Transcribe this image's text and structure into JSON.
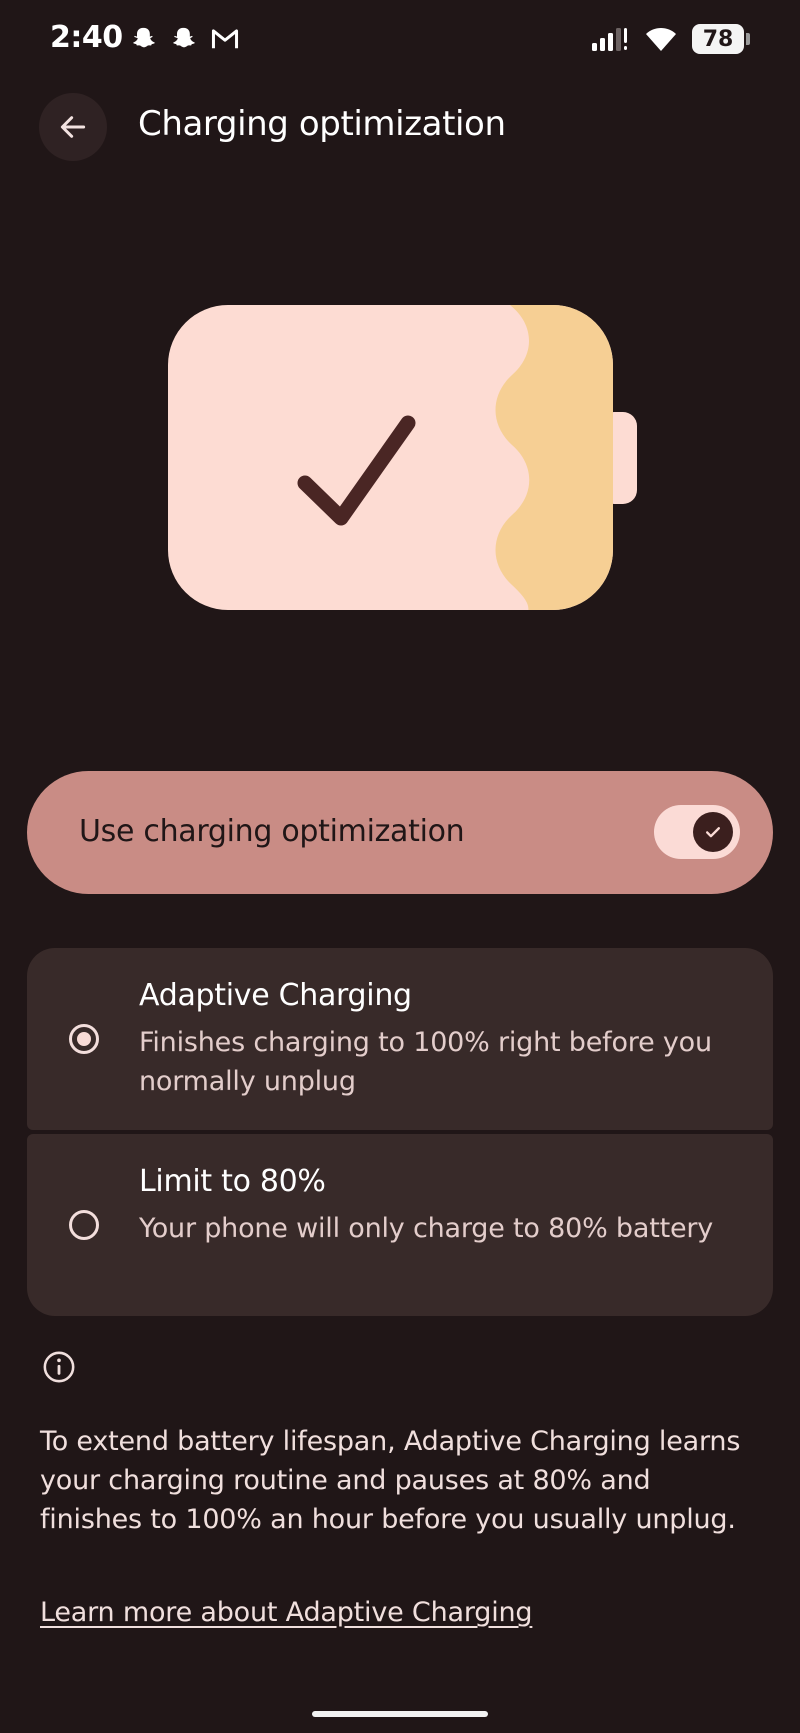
{
  "status_bar": {
    "time": "2:40",
    "notification_icons": [
      "snapchat-icon",
      "snapchat-icon",
      "gmail-icon"
    ],
    "battery_level": "78"
  },
  "app_bar": {
    "title": "Charging optimization"
  },
  "toggle": {
    "label": "Use charging optimization",
    "enabled": true
  },
  "options": [
    {
      "title": "Adaptive Charging",
      "description": "Finishes charging to 100% right before you normally unplug",
      "selected": true
    },
    {
      "title": "Limit to 80%",
      "description": "Your phone will only charge to 80% battery",
      "selected": false
    }
  ],
  "info": {
    "text": "To extend battery lifespan, Adaptive Charging learns your charging routine and pauses at 80% and finishes to 100% an hour before you usually unplug.",
    "link": "Learn more about Adaptive Charging"
  },
  "colors": {
    "background": "#201617",
    "toggle_card": "#c98c85",
    "option_card": "#382a29",
    "battery_body": "#fddcd3",
    "battery_wave": "#f6cf94"
  }
}
